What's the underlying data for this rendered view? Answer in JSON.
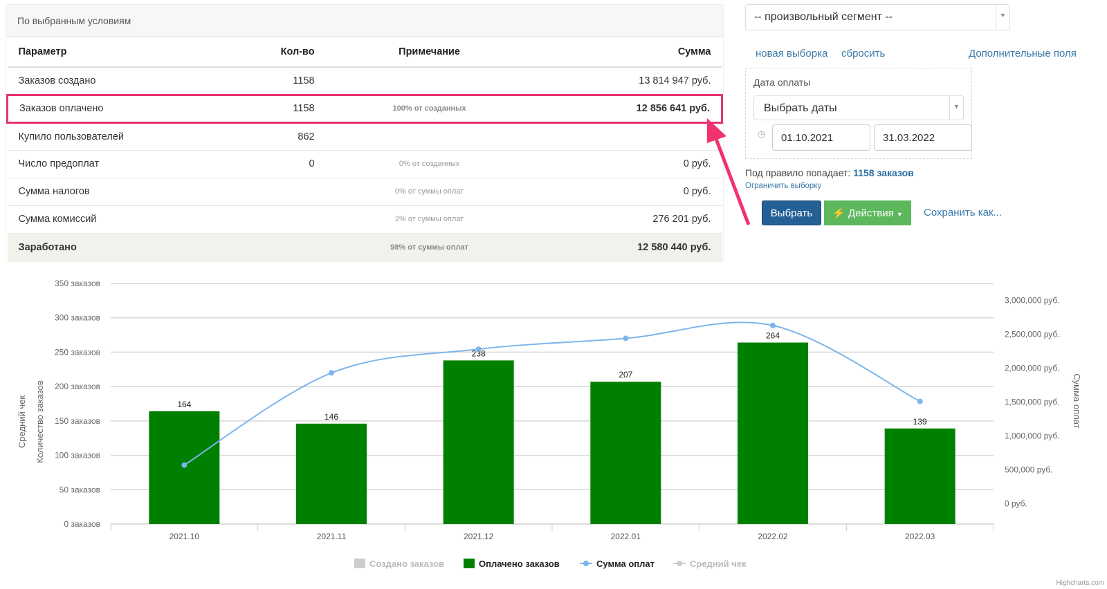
{
  "panel": {
    "title": "По выбранным условиям",
    "columns": [
      "Параметр",
      "Кол-во",
      "Примечание",
      "Сумма"
    ],
    "rows": [
      {
        "param": "Заказов создано",
        "qty": "1158",
        "note": "",
        "sum": "13 814 947 руб."
      },
      {
        "param": "Заказов оплачено",
        "qty": "1158",
        "note": "100% от созданных",
        "sum": "12 856 641 руб.",
        "highlighted": true
      },
      {
        "param": "Купило пользователей",
        "qty": "862",
        "note": "",
        "sum": ""
      },
      {
        "param": "Число предоплат",
        "qty": "0",
        "note": "0% от созданных",
        "sum": "0 руб."
      },
      {
        "param": "Сумма налогов",
        "qty": "",
        "note": "0% от суммы оплат",
        "sum": "0 руб."
      },
      {
        "param": "Сумма комиссий",
        "qty": "",
        "note": "2% от суммы оплат",
        "sum": "276 201 руб."
      }
    ],
    "total": {
      "param": "Заработано",
      "note": "98% от суммы оплат",
      "sum": "12 580 440 руб."
    }
  },
  "filters": {
    "segment": "-- произвольный сегмент --",
    "new_selection": "новая выборка",
    "reset": "сбросить",
    "extra_fields": "Дополнительные поля",
    "date_label": "Дата оплаты",
    "date_mode": "Выбрать даты",
    "date_from": "01.10.2021",
    "date_to": "31.03.2022",
    "rule_prefix": "Под правило попадает:",
    "rule_count": "1158 заказов",
    "limit": "Ограничить выборку",
    "select_btn": "Выбрать",
    "actions_btn": "Действия",
    "save_as": "Сохранить как..."
  },
  "colors": {
    "highlight": "#e8336e",
    "bars": "#008000",
    "line": "#7cb5ec",
    "primary": "#245f96",
    "success": "#5cb85c"
  },
  "chart_data": {
    "type": "bar+line",
    "categories": [
      "2021.10",
      "2021.11",
      "2021.12",
      "2022.01",
      "2022.02",
      "2022.03"
    ],
    "series": [
      {
        "name": "Создано заказов",
        "type": "bar",
        "visible": false,
        "values": []
      },
      {
        "name": "Оплачено заказов",
        "type": "bar",
        "axis": "left",
        "values": [
          164,
          146,
          238,
          207,
          264,
          139
        ]
      },
      {
        "name": "Сумма оплат",
        "type": "spline",
        "axis": "right",
        "values": [
          570000,
          1930000,
          2280000,
          2440000,
          2630000,
          1510000
        ]
      },
      {
        "name": "Средний чек",
        "type": "line",
        "visible": false,
        "values": []
      }
    ],
    "yleft": {
      "label1": "Средний чек",
      "label2": "Количество заказов",
      "range": [
        0,
        350
      ],
      "ticks": [
        "0 заказов",
        "50 заказов",
        "100 заказов",
        "150 заказов",
        "200 заказов",
        "250 заказов",
        "300 заказов",
        "350 заказов"
      ]
    },
    "yright": {
      "label": "Сумма оплат",
      "range": [
        -300000,
        3250000
      ],
      "ticks": [
        "0 руб.",
        "500,000 руб.",
        "1,000,000 руб.",
        "1,500,000 руб.",
        "2,000,000 руб.",
        "2,500,000 руб.",
        "3,000,000 руб."
      ]
    },
    "grid": true,
    "legend": "bottom",
    "credit": "Highcharts.com"
  }
}
